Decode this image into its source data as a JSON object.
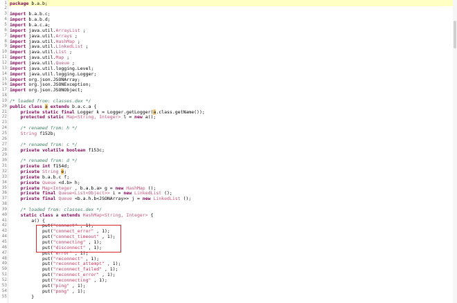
{
  "editor": {
    "lines": [
      {
        "n": "1",
        "t": [
          [
            "kw",
            "package"
          ],
          [
            "",
            "b.a.b;"
          ]
        ]
      },
      {
        "n": "2",
        "t": []
      },
      {
        "n": "3",
        "t": [
          [
            "kw",
            "import"
          ],
          [
            "",
            "b.a.b.c;"
          ]
        ]
      },
      {
        "n": "4",
        "t": [
          [
            "kw",
            "import"
          ],
          [
            "",
            "b.a.b.d;"
          ]
        ]
      },
      {
        "n": "5",
        "t": [
          [
            "kw",
            "import"
          ],
          [
            "",
            "b.a.c.a;"
          ]
        ]
      },
      {
        "n": "6",
        "t": [
          [
            "kw",
            "import"
          ],
          [
            "",
            "java.util."
          ],
          [
            "ty",
            "ArrayList"
          ],
          [
            "",
            ";"
          ]
        ]
      },
      {
        "n": "7",
        "t": [
          [
            "kw",
            "import"
          ],
          [
            "",
            "java.util."
          ],
          [
            "ty",
            "Arrays"
          ],
          [
            "",
            ";"
          ]
        ]
      },
      {
        "n": "8",
        "t": [
          [
            "kw",
            "import"
          ],
          [
            "",
            "java.util."
          ],
          [
            "ty",
            "HashMap"
          ],
          [
            "",
            ";"
          ]
        ]
      },
      {
        "n": "9",
        "t": [
          [
            "kw",
            "import"
          ],
          [
            "",
            "java.util."
          ],
          [
            "ty",
            "LinkedList"
          ],
          [
            "",
            ";"
          ]
        ]
      },
      {
        "n": "10",
        "t": [
          [
            "kw",
            "import"
          ],
          [
            "",
            "java.util."
          ],
          [
            "ty",
            "List"
          ],
          [
            "",
            ";"
          ]
        ]
      },
      {
        "n": "11",
        "t": [
          [
            "kw",
            "import"
          ],
          [
            "",
            "java.util."
          ],
          [
            "ty",
            "Map"
          ],
          [
            "",
            ";"
          ]
        ]
      },
      {
        "n": "12",
        "t": [
          [
            "kw",
            "import"
          ],
          [
            "",
            "java.util."
          ],
          [
            "ty",
            "Queue"
          ],
          [
            "",
            ";"
          ]
        ]
      },
      {
        "n": "13",
        "t": [
          [
            "kw",
            "import"
          ],
          [
            "",
            "java.util.logging.Level;"
          ]
        ]
      },
      {
        "n": "14",
        "t": [
          [
            "kw",
            "import"
          ],
          [
            "",
            "java.util.logging.Logger;"
          ]
        ]
      },
      {
        "n": "15",
        "t": [
          [
            "kw",
            "import"
          ],
          [
            "",
            "org.json.JSONArray;"
          ]
        ]
      },
      {
        "n": "16",
        "t": [
          [
            "kw",
            "import"
          ],
          [
            "",
            "org.json.JSONException;"
          ]
        ]
      },
      {
        "n": "17",
        "t": [
          [
            "kw",
            "import"
          ],
          [
            "",
            "org.json.JSONObject;"
          ]
        ]
      },
      {
        "n": "18",
        "t": []
      },
      {
        "n": "19",
        "t": [
          [
            "cm",
            "/* loaded from: classes.dex */"
          ]
        ]
      },
      {
        "n": "20",
        "t": [
          [
            "kw",
            "public class"
          ],
          [
            "mk",
            "a"
          ],
          [
            "",
            ""
          ],
          [
            "kw",
            "extends"
          ],
          [
            "",
            "b.a.c.a {"
          ]
        ]
      },
      {
        "n": "21",
        "t": [
          [
            "",
            "    "
          ],
          [
            "kw",
            "private static final"
          ],
          [
            "",
            "Logger k = Logger.getLogger("
          ],
          [
            "mk",
            "a"
          ],
          [
            "",
            ".class.getName());"
          ]
        ]
      },
      {
        "n": "22",
        "t": [
          [
            "",
            "    "
          ],
          [
            "kw",
            "protected static"
          ],
          [
            "ty",
            "Map<String, Integer>"
          ],
          [
            "",
            "l = "
          ],
          [
            "kw",
            "new"
          ],
          [
            "",
            "a();"
          ]
        ]
      },
      {
        "n": "23",
        "t": []
      },
      {
        "n": "24",
        "t": [
          [
            "",
            "    "
          ],
          [
            "cm",
            "/* renamed from: h */"
          ]
        ]
      },
      {
        "n": "25",
        "t": [
          [
            "",
            "    "
          ],
          [
            "ty",
            "String"
          ],
          [
            "",
            "f152b;"
          ]
        ]
      },
      {
        "n": "26",
        "t": []
      },
      {
        "n": "27",
        "t": [
          [
            "",
            "    "
          ],
          [
            "cm",
            "/* renamed from: c */"
          ]
        ]
      },
      {
        "n": "28",
        "t": [
          [
            "",
            "    "
          ],
          [
            "kw",
            "private volatile boolean"
          ],
          [
            "",
            "f153c;"
          ]
        ]
      },
      {
        "n": "29",
        "t": []
      },
      {
        "n": "30",
        "t": [
          [
            "",
            "    "
          ],
          [
            "cm",
            "/* renamed from: d */"
          ]
        ]
      },
      {
        "n": "31",
        "t": [
          [
            "",
            "    "
          ],
          [
            "kw",
            "private int"
          ],
          [
            "",
            "f154d;"
          ]
        ]
      },
      {
        "n": "32",
        "t": [
          [
            "",
            "    "
          ],
          [
            "kw",
            "private"
          ],
          [
            "ty",
            "String"
          ],
          [
            "mk",
            "e"
          ],
          [
            "",
            ";"
          ]
        ]
      },
      {
        "n": "33",
        "t": [
          [
            "",
            "    "
          ],
          [
            "kw",
            "private"
          ],
          [
            "",
            "b.a.b.c f;"
          ]
        ]
      },
      {
        "n": "34",
        "t": [
          [
            "",
            "    "
          ],
          [
            "kw",
            "private"
          ],
          [
            "ty",
            "Queue"
          ],
          [
            "",
            "<d.b> h;"
          ]
        ]
      },
      {
        "n": "35",
        "t": [
          [
            "",
            "    "
          ],
          [
            "kw",
            "private"
          ],
          [
            "ty",
            "Map<Integer"
          ],
          [
            "",
            ", b.a.b.a> g = "
          ],
          [
            "kw",
            "new"
          ],
          [
            "ty",
            "HashMap"
          ],
          [
            "",
            "();"
          ]
        ]
      },
      {
        "n": "36",
        "t": [
          [
            "",
            "    "
          ],
          [
            "kw",
            "private final"
          ],
          [
            "ty",
            "Queue<List<Object>>"
          ],
          [
            "",
            "i = "
          ],
          [
            "kw",
            "new"
          ],
          [
            "ty",
            "LinkedList"
          ],
          [
            "",
            "();"
          ]
        ]
      },
      {
        "n": "37",
        "t": [
          [
            "",
            "    "
          ],
          [
            "kw",
            "private final"
          ],
          [
            "ty",
            "Queue"
          ],
          [
            "",
            "<b.a.h.b<JSONArray>> j = "
          ],
          [
            "kw",
            "new"
          ],
          [
            "ty",
            "LinkedList"
          ],
          [
            "",
            "();"
          ]
        ]
      },
      {
        "n": "38",
        "t": []
      },
      {
        "n": "39",
        "t": [
          [
            "",
            "    "
          ],
          [
            "cm",
            "/* loaded from: classes.dex */"
          ]
        ]
      },
      {
        "n": "40",
        "t": [
          [
            "",
            "    "
          ],
          [
            "kw",
            "static class"
          ],
          [
            "",
            "a "
          ],
          [
            "kw",
            "extends"
          ],
          [
            "ty",
            "HashMap<String, Integer>"
          ],
          [
            "",
            "{"
          ]
        ]
      },
      {
        "n": "41",
        "t": [
          [
            "",
            "        a() {"
          ]
        ]
      },
      {
        "n": "42",
        "t": [
          [
            "",
            "            put("
          ],
          [
            "str",
            "\"connect\""
          ],
          [
            "",
            ", 1);"
          ]
        ]
      },
      {
        "n": "43",
        "t": [
          [
            "",
            "            put("
          ],
          [
            "str",
            "\"connect_error\""
          ],
          [
            "",
            ", 1);"
          ]
        ]
      },
      {
        "n": "44",
        "t": [
          [
            "",
            "            put("
          ],
          [
            "str",
            "\"connect_timeout\""
          ],
          [
            "",
            ", 1);"
          ]
        ]
      },
      {
        "n": "45",
        "t": [
          [
            "",
            "            put("
          ],
          [
            "str",
            "\"connecting\""
          ],
          [
            "",
            ", 1);"
          ]
        ]
      },
      {
        "n": "46",
        "t": [
          [
            "",
            "            put("
          ],
          [
            "str",
            "\"disconnect\""
          ],
          [
            "",
            ", 1);"
          ]
        ]
      },
      {
        "n": "47",
        "t": [
          [
            "",
            "            put("
          ],
          [
            "str",
            "\"error\""
          ],
          [
            "",
            ", 1);"
          ]
        ]
      },
      {
        "n": "48",
        "t": [
          [
            "",
            "            put("
          ],
          [
            "str",
            "\"reconnect\""
          ],
          [
            "",
            ", 1);"
          ]
        ]
      },
      {
        "n": "49",
        "t": [
          [
            "",
            "            put("
          ],
          [
            "str",
            "\"reconnect_attempt\""
          ],
          [
            "",
            ", 1);"
          ]
        ]
      },
      {
        "n": "50",
        "t": [
          [
            "",
            "            put("
          ],
          [
            "str",
            "\"reconnect_failed\""
          ],
          [
            "",
            ", 1);"
          ]
        ]
      },
      {
        "n": "51",
        "t": [
          [
            "",
            "            put("
          ],
          [
            "str",
            "\"reconnect_error\""
          ],
          [
            "",
            ", 1);"
          ]
        ]
      },
      {
        "n": "52",
        "t": [
          [
            "",
            "            put("
          ],
          [
            "str",
            "\"reconnecting\""
          ],
          [
            "",
            ", 1);"
          ]
        ]
      },
      {
        "n": "53",
        "t": [
          [
            "",
            "            put("
          ],
          [
            "str",
            "\"ping\""
          ],
          [
            "",
            ", 1);"
          ]
        ]
      },
      {
        "n": "54",
        "t": [
          [
            "",
            "            put("
          ],
          [
            "str",
            "\"pong\""
          ],
          [
            "",
            ", 1);"
          ]
        ]
      },
      {
        "n": "55",
        "t": [
          [
            "",
            "        }"
          ]
        ]
      }
    ]
  },
  "colors": {
    "keyword": "#7f0055",
    "string": "#c8325a",
    "comment": "#3f7f5f",
    "type": "#c0507a",
    "highlight_box": "#d8212b",
    "current_line": "#ffffc4"
  }
}
